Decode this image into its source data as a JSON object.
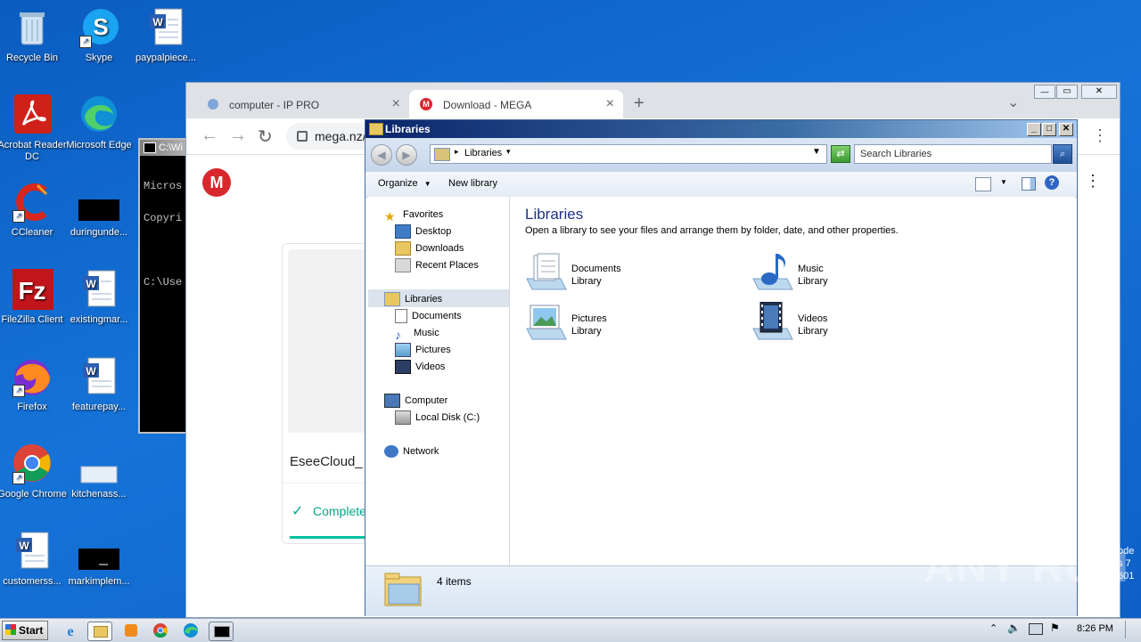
{
  "desktop": {
    "icons": [
      {
        "label": "Recycle Bin"
      },
      {
        "label": "Skype"
      },
      {
        "label": "paypalpiece..."
      },
      {
        "label": "Acrobat Reader DC"
      },
      {
        "label": "Microsoft Edge"
      },
      {
        "label": "CCleaner"
      },
      {
        "label": "duringunde..."
      },
      {
        "label": "FileZilla Client"
      },
      {
        "label": "existingmar..."
      },
      {
        "label": "Firefox"
      },
      {
        "label": "featurepay..."
      },
      {
        "label": "Google Chrome"
      },
      {
        "label": "kitchenass..."
      },
      {
        "label": "customerss..."
      },
      {
        "label": "markimplem..."
      }
    ],
    "cmd_lines": [
      "C:\\Wi",
      "Micros",
      "Copyri",
      "C:\\Use"
    ],
    "watermark": "ANY RUN",
    "corner_text": [
      "ode",
      "s 7",
      "601"
    ]
  },
  "chrome": {
    "tabs": [
      {
        "title": "computer - IP PRO",
        "close": "×"
      },
      {
        "title": "Download - MEGA",
        "close": "×"
      }
    ],
    "new_tab": "+",
    "tab_search": "⌄",
    "window_buttons": {
      "min": "—",
      "max": "▭",
      "close": "✕"
    },
    "url": "mega.nz/",
    "page": {
      "file_name": "EseeCloud_",
      "status": "Complete",
      "logo": "M"
    }
  },
  "explorer": {
    "title": "Libraries",
    "breadcrumb": "Libraries",
    "search_placeholder": "Search Libraries",
    "toolbar": {
      "organize": "Organize",
      "new_library": "New library"
    },
    "nav": {
      "favorites": "Favorites",
      "desktop": "Desktop",
      "downloads": "Downloads",
      "recent": "Recent Places",
      "libraries": "Libraries",
      "documents": "Documents",
      "music": "Music",
      "pictures": "Pictures",
      "videos": "Videos",
      "computer": "Computer",
      "local_disk": "Local Disk (C:)",
      "network": "Network"
    },
    "heading": "Libraries",
    "description": "Open a library to see your files and arrange them by folder, date, and other properties.",
    "items": [
      {
        "name": "Documents",
        "type": "Library"
      },
      {
        "name": "Music",
        "type": "Library"
      },
      {
        "name": "Pictures",
        "type": "Library"
      },
      {
        "name": "Videos",
        "type": "Library"
      }
    ],
    "status": "4 items"
  },
  "taskbar": {
    "start": "Start",
    "clock": "8:26 PM"
  }
}
